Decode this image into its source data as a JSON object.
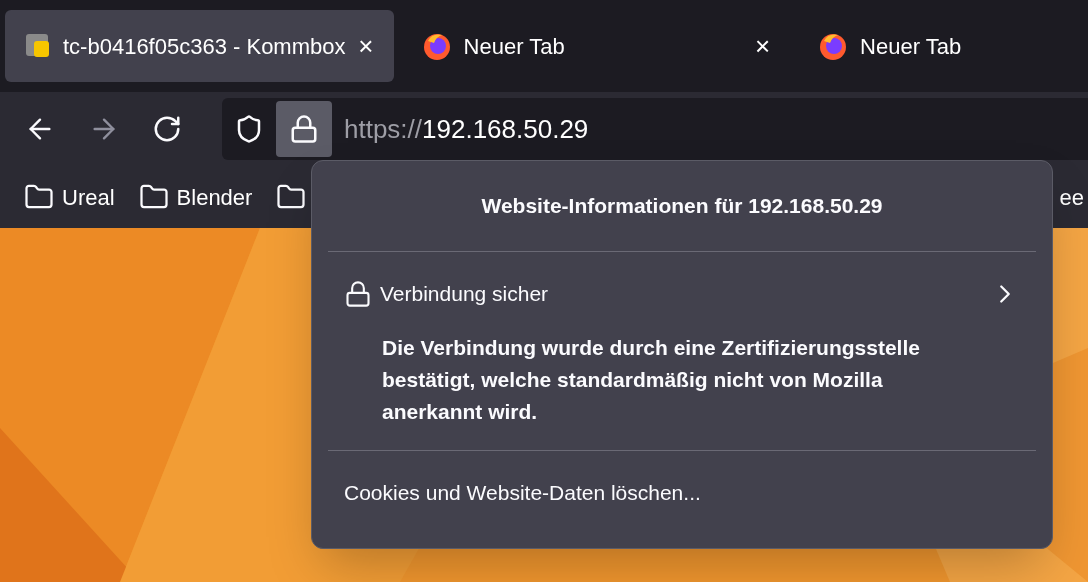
{
  "tabs": [
    {
      "kind": "site",
      "title": "tc-b0416f05c363 - Kommbox",
      "selected": true,
      "close": "×"
    },
    {
      "kind": "firefox",
      "title": "Neuer Tab",
      "selected": false,
      "close": "×"
    },
    {
      "kind": "firefox",
      "title": "Neuer Tab",
      "selected": false
    }
  ],
  "url": {
    "scheme": "https://",
    "host": "192.168.50.29"
  },
  "bookmarks": [
    {
      "kind": "folder",
      "label": "Ureal"
    },
    {
      "kind": "folder",
      "label": "Blender"
    },
    {
      "kind": "folder"
    }
  ],
  "bookmark_cut": "ee",
  "popup": {
    "title": "Website-Informationen für 192.168.50.29",
    "connection": "Verbindung sicher",
    "message": "Die Verbindung wurde durch eine Zertifizierungsstelle bestätigt, welche standardmäßig nicht von Mozilla anerkannt wird.",
    "action": "Cookies und Website-Daten löschen..."
  }
}
